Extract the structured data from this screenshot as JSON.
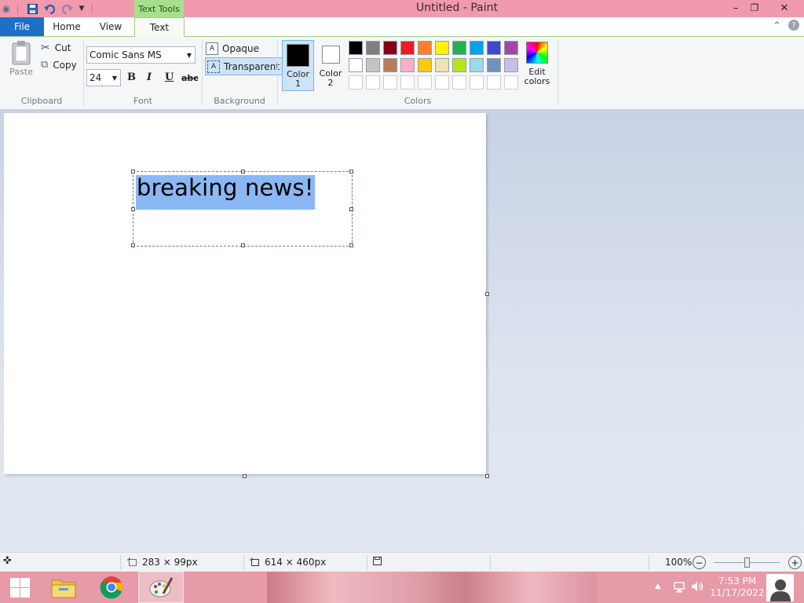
{
  "window": {
    "title": "Untitled - Paint",
    "context_group": "Text Tools",
    "controls": {
      "minimize": "–",
      "restore": "❐",
      "close": "✕"
    }
  },
  "tabs": {
    "file": "File",
    "home": "Home",
    "view": "View",
    "text": "Text",
    "active": "Text"
  },
  "clipboard": {
    "paste": "Paste",
    "cut": "Cut",
    "copy": "Copy",
    "group_label": "Clipboard"
  },
  "font": {
    "family": "Comic Sans MS",
    "size": "24",
    "bold": "B",
    "italic": "I",
    "underline": "U",
    "strikethrough": "abc",
    "group_label": "Font"
  },
  "background": {
    "opaque": "Opaque",
    "transparent": "Transparent",
    "selected": "Transparent",
    "group_label": "Background"
  },
  "colors": {
    "color1_label_line1": "Color",
    "color1_label_line2": "1",
    "color2_label_line1": "Color",
    "color2_label_line2": "2",
    "color1_value": "#000000",
    "color2_value": "#ffffff",
    "edit_colors_line1": "Edit",
    "edit_colors_line2": "colors",
    "group_label": "Colors",
    "palette_row1": [
      "#000000",
      "#7f7f7f",
      "#880015",
      "#ed1c24",
      "#ff7f27",
      "#fff200",
      "#22b14c",
      "#00a2e8",
      "#3f48cc",
      "#a349a4"
    ],
    "palette_row2": [
      "#ffffff",
      "#c3c3c3",
      "#b97a57",
      "#ffaec9",
      "#ffc90e",
      "#efe4b0",
      "#b5e61d",
      "#99d9ea",
      "#7092be",
      "#c8bfe7"
    ],
    "palette_row3": [
      "#ffffff",
      "#ffffff",
      "#ffffff",
      "#ffffff",
      "#ffffff",
      "#ffffff",
      "#ffffff",
      "#ffffff",
      "#ffffff",
      "#ffffff"
    ]
  },
  "canvas": {
    "text": "breaking news!",
    "background": "#ffffff",
    "selection_color": "#8ab8f4"
  },
  "status": {
    "selection_size": "283 × 99px",
    "canvas_size": "614 × 460px",
    "zoom": "100%",
    "zoom_level": 1.0
  },
  "taskbar": {
    "time": "7:53 PM",
    "date": "11/17/2022"
  }
}
